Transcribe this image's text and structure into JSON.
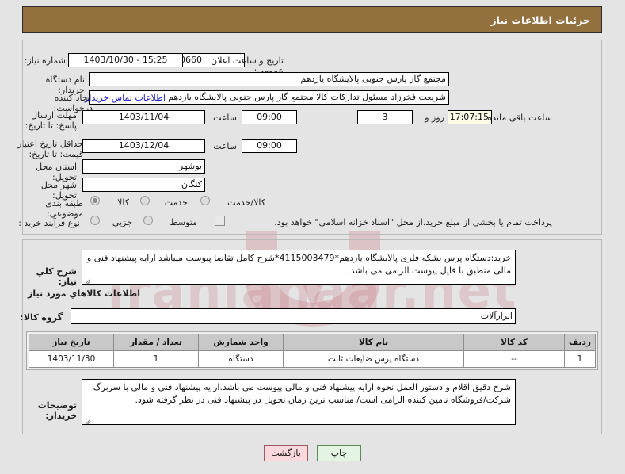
{
  "header": {
    "title": "جزئیات اطلاعات نیاز"
  },
  "form": {
    "need_number_label": "شماره نیاز:",
    "need_number_value": "1103096697000660",
    "announce_label": "تاریخ و ساعت اعلان عمومی:",
    "announce_value": "15:25 - 1403/10/30",
    "buyer_org_label": "نام دستگاه خریدار:",
    "buyer_org_value": "مجتمع گاز پارس جنوبی  پالایشگاه یازدهم",
    "creator_label": "ایجاد کننده درخواست:",
    "creator_value": "شریعت فخرزاد مسئول تدارکات کالا مجتمع گاز پارس جنوبی  پالایشگاه یازدهم",
    "contact_link": "اطلاعات تماس خریدار",
    "deadline_label": "مهلت ارسال پاسخ: تا تاریخ:",
    "deadline_date": "1403/11/04",
    "hour_label": "ساعت",
    "deadline_time": "09:00",
    "remaining_days": "3",
    "days_and_label": "روز و",
    "remaining_time": "17:07:15",
    "remaining_label": "ساعت باقی مانده",
    "validity_label": "حداقل تاریخ اعتبار قیمت: تا تاریخ:",
    "validity_date": "1403/12/04",
    "validity_time": "09:00",
    "province_label": "استان محل تحویل:",
    "province_value": "بوشهر",
    "city_label": "شهر محل تحویل:",
    "city_value": "کنگان",
    "category_label": "طبقه بندی موضوعی:",
    "category_options": [
      {
        "label": "کالا",
        "selected": true
      },
      {
        "label": "خدمت",
        "selected": false
      },
      {
        "label": "کالا/خدمت",
        "selected": false
      }
    ],
    "process_label": "نوع فرآیند خرید :",
    "process_options": [
      {
        "label": "جزیی",
        "selected": false
      },
      {
        "label": "متوسط",
        "selected": false
      }
    ],
    "treasury_checkbox_label": "پرداخت تمام یا بخشی از مبلغ خرید،از محل \"اسناد خزانه اسلامی\" خواهد بود.",
    "treasury_checked": false
  },
  "description": {
    "label": "شرح کلي نياز:",
    "value": "خرید:دستگاه پرس بشکه فلزی پالایشگاه یازدهم*4115003479*شرح کامل تقاضا پیوست میباشد ارایه پیشنهاد فنی و مالی منطبق با فایل پیوست الزامی می باشد."
  },
  "goods_section": {
    "title": "اطلاعات کالاهاي مورد نياز",
    "group_label": "گروه کالا:",
    "group_value": "ابزارآلات",
    "columns": [
      "ردیف",
      "کد کالا",
      "نام کالا",
      "واحد شمارش",
      "تعداد / مقدار",
      "تاریخ نیاز"
    ],
    "rows": [
      {
        "index": "1",
        "code": "--",
        "name": "دستگاه پرس ضایعات ثابت",
        "unit": "دستگاه",
        "quantity": "1",
        "need_date": "1403/11/30"
      }
    ]
  },
  "buyer_notes": {
    "label": "توضیحات خریدار:",
    "value": "شرح دقیق اقلام و دستور العمل نحوه ارایه پیشنهاد فنی و مالی پیوست می باشد.ارایه پیشنهاد فنی و مالی با سربرگ شرکت/فروشگاه تامین کننده الزامی است/ مناسب ترین زمان تحویل در پیشنهاد فنی در نظر گرفته شود."
  },
  "buttons": {
    "print": "چاپ",
    "back": "بازگشت"
  },
  "watermark": {
    "text": "iranianaar.net"
  },
  "colors": {
    "header_bg": "#93713f",
    "link": "#2020c8",
    "print_btn": "#e4f4e2",
    "back_btn": "#f9d9dc"
  }
}
